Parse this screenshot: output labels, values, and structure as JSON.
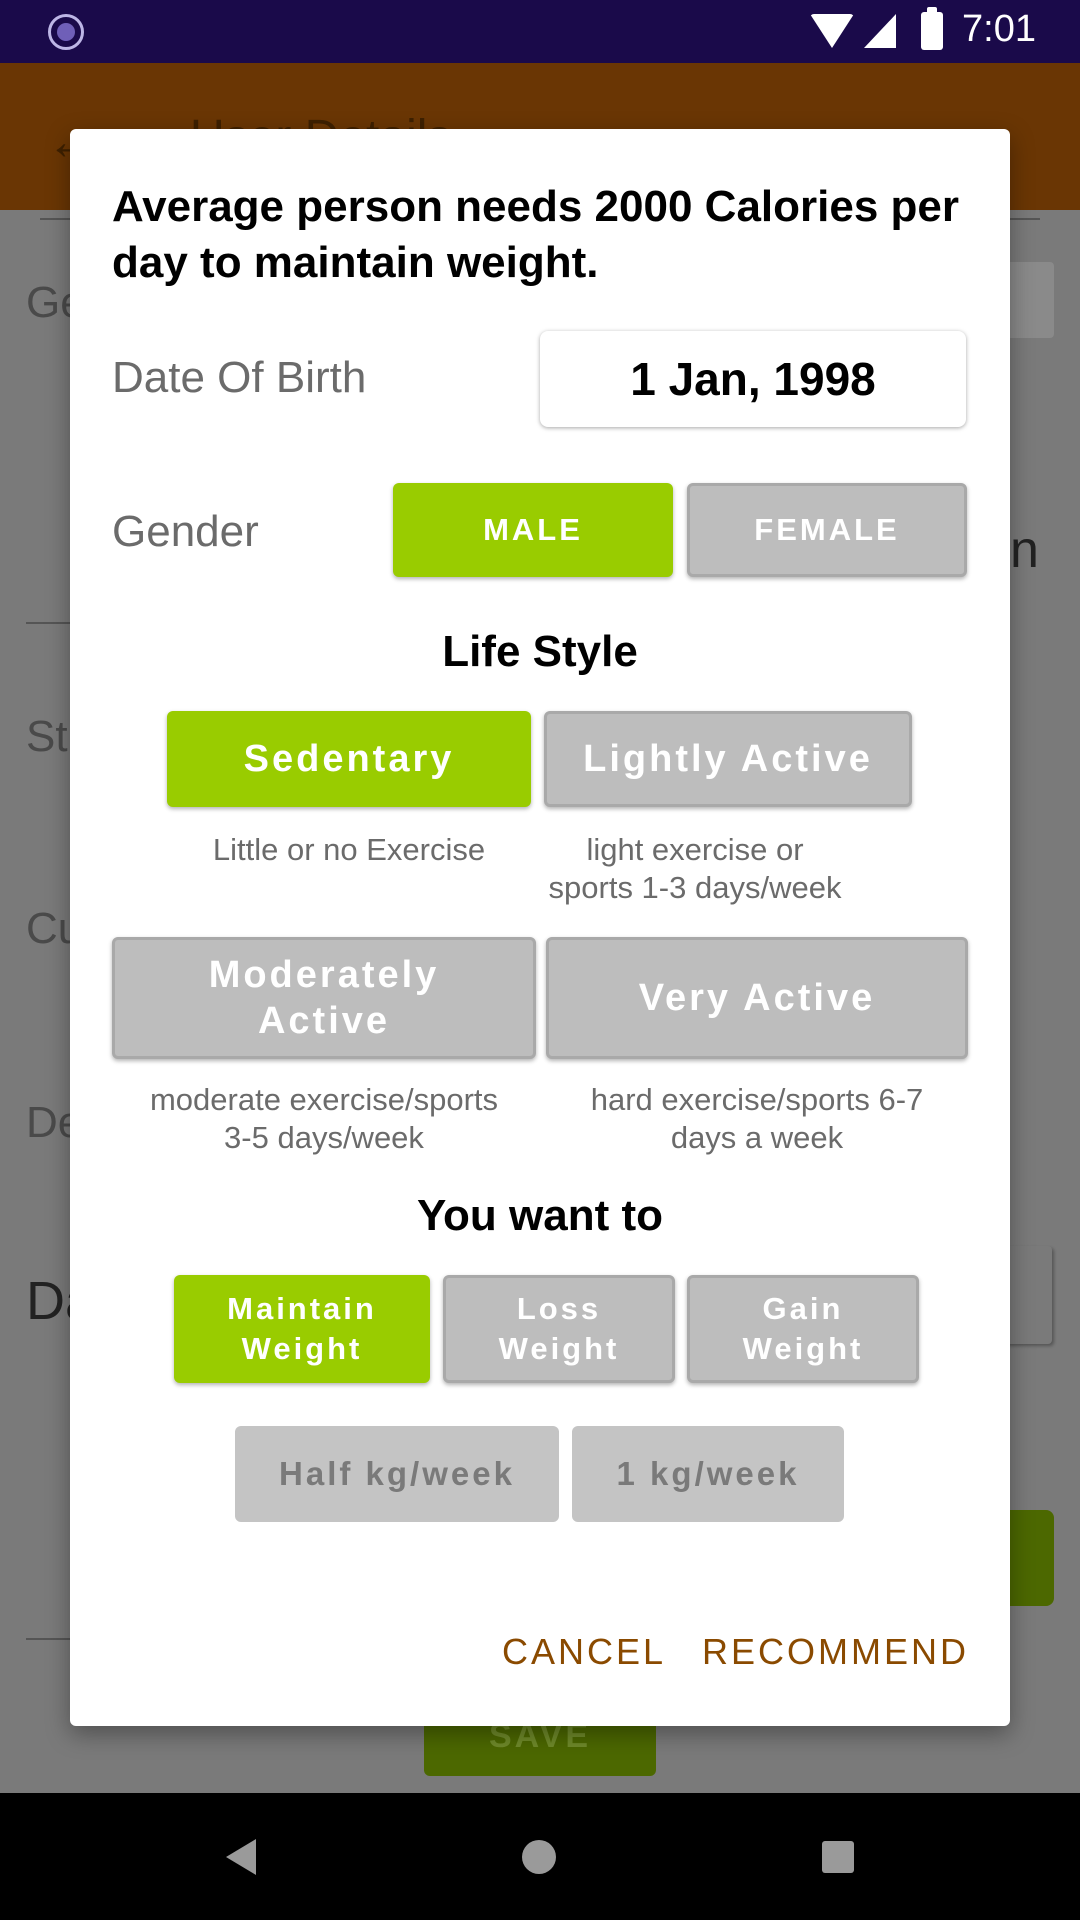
{
  "status_bar": {
    "time": "7:01"
  },
  "app_bar": {
    "title": "User Details"
  },
  "background_screen": {
    "labels": [
      "Ge",
      "St",
      "Cu",
      "De",
      "Da"
    ],
    "partial_text": "n",
    "save_button": "SAVE"
  },
  "dialog": {
    "title": "Average person needs 2000 Calories per day to maintain weight.",
    "dob_label": "Date Of Birth",
    "dob_value": "1 Jan, 1998",
    "gender_label": "Gender",
    "gender_male": "MALE",
    "gender_female": "FEMALE",
    "lifestyle_title": "Life Style",
    "lifestyle": {
      "sedentary": {
        "label": "Sedentary",
        "desc": "Little or no Exercise"
      },
      "lightly_active": {
        "label": "Lightly Active",
        "desc_1": "light exercise or",
        "desc_2": "sports 1-3 days/week"
      },
      "moderately_active": {
        "label_1": "Moderately",
        "label_2": "Active",
        "desc_1": "moderate exercise/sports",
        "desc_2": "3-5 days/week"
      },
      "very_active": {
        "label": "Very Active",
        "desc_1": "hard exercise/sports 6-7",
        "desc_2": "days a week"
      }
    },
    "goal_title": "You want to",
    "goals": {
      "maintain": {
        "label_1": "Maintain",
        "label_2": "Weight"
      },
      "loss": {
        "label_1": "Loss",
        "label_2": "Weight"
      },
      "gain": {
        "label_1": "Gain",
        "label_2": "Weight"
      }
    },
    "rates": {
      "half": "Half kg/week",
      "one": "1 kg/week"
    },
    "actions": {
      "cancel": "CANCEL",
      "recommend": "RECOMMEND"
    }
  },
  "colors": {
    "selected": "#99cc00",
    "unselected": "#bdbdbd",
    "action_text": "#8a4a00",
    "status_bar": "#1a0a4a",
    "app_bar": "#6a3604"
  }
}
